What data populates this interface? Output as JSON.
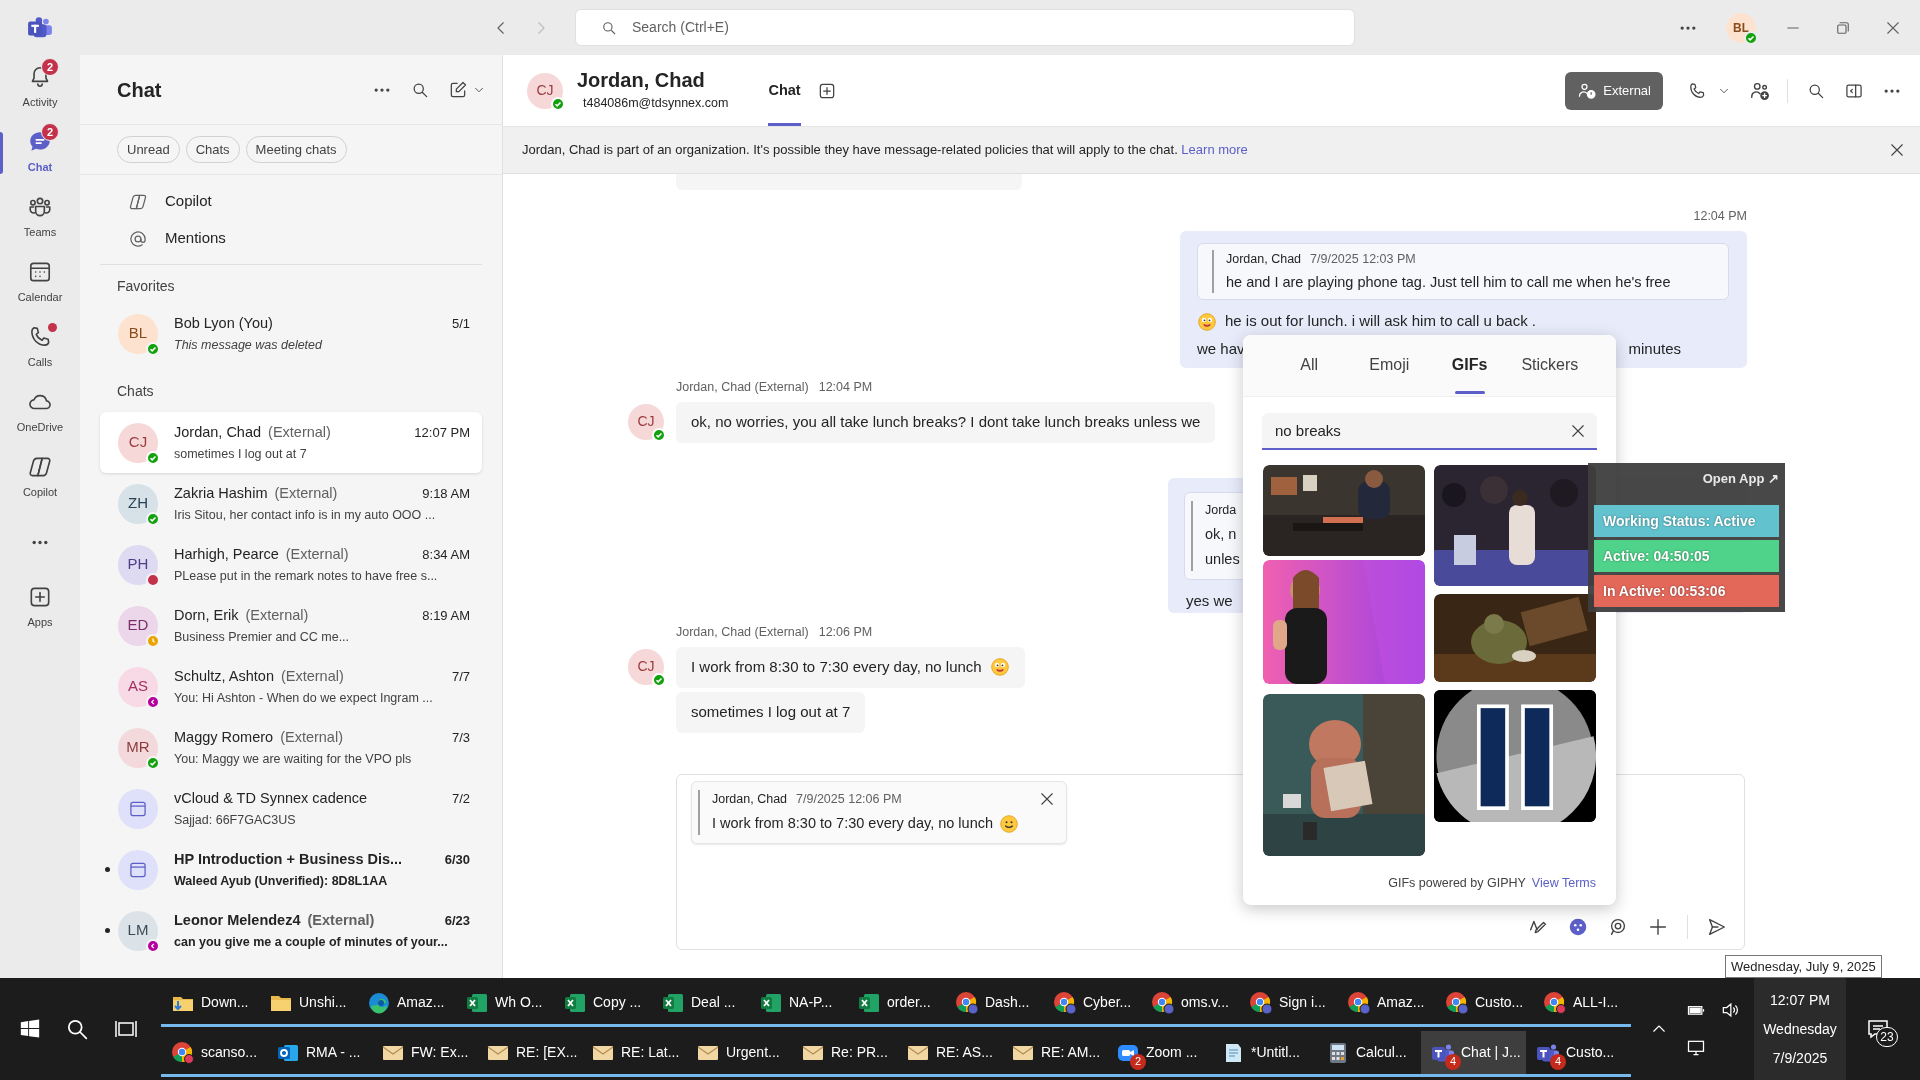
{
  "title_bar": {
    "search_placeholder": "Search (Ctrl+E)",
    "user": {
      "initials": "BL",
      "color": "#13a10e"
    }
  },
  "app_rail": [
    {
      "kind": "activity",
      "label": "Activity",
      "badge": "2",
      "dot": false,
      "selected": false
    },
    {
      "kind": "chat",
      "label": "Chat",
      "badge": "2",
      "dot": false,
      "selected": true
    },
    {
      "kind": "teams",
      "label": "Teams",
      "dot": false,
      "selected": false
    },
    {
      "kind": "calendar",
      "label": "Calendar",
      "dot": false,
      "selected": false
    },
    {
      "kind": "calls",
      "label": "Calls",
      "dot": true,
      "selected": false
    },
    {
      "kind": "onedrive",
      "label": "OneDrive",
      "dot": false,
      "selected": false
    },
    {
      "kind": "copilot",
      "label": "Copilot",
      "dot": false,
      "selected": false
    },
    {
      "kind": "more",
      "dot": false,
      "selected": false
    },
    {
      "kind": "apps",
      "label": "Apps",
      "dot": false,
      "selected": false
    }
  ],
  "chat_list": {
    "title": "Chat",
    "filters": [
      {
        "label": "Unread",
        "selected": false
      },
      {
        "label": "Chats",
        "selected": false
      },
      {
        "label": "Meeting chats",
        "selected": false
      }
    ],
    "shortcuts": [
      {
        "kind": "copilot",
        "label": "Copilot"
      },
      {
        "kind": "mentions",
        "label": "Mentions"
      }
    ],
    "favorites_heading": "Favorites",
    "favorites": [
      {
        "kind": "person",
        "initials": "BL",
        "name": "Bob Lyon (You)",
        "preview": "This message was deleted",
        "deleted": true,
        "time": "5/1",
        "color": "#13a10e",
        "unread": false,
        "selected": false
      }
    ],
    "chats_heading": "Chats",
    "chats": [
      {
        "kind": "person",
        "initials": "CJ",
        "name": "Jordan, Chad",
        "tag": "(External)",
        "preview": "sometimes I log out at 7",
        "deleted": false,
        "time": "12:07 PM",
        "color": "#13a10e",
        "unread": false,
        "selected": true
      },
      {
        "kind": "person",
        "initials": "ZH",
        "name": "Zakria Hashim",
        "tag": "(External)",
        "preview": "Iris Sitou, her contact info is in my auto OOO ...",
        "deleted": false,
        "time": "9:18 AM",
        "color": "#13a10e",
        "unread": false,
        "selected": false
      },
      {
        "kind": "person",
        "initials": "PH",
        "name": "Harhigh, Pearce",
        "tag": "(External)",
        "preview": "PLease put in the remark notes to have free s...",
        "deleted": false,
        "time": "8:34 AM",
        "color": "#c4314b",
        "unread": false,
        "selected": false
      },
      {
        "kind": "person",
        "initials": "ED",
        "name": "Dorn, Erik",
        "tag": "(External)",
        "preview": "Business Premier and CC me...",
        "deleted": false,
        "time": "8:19 AM",
        "color": "#eaa300",
        "unread": false,
        "selected": false
      },
      {
        "kind": "person",
        "initials": "AS",
        "name": "Schultz, Ashton",
        "tag": "(External)",
        "preview": "You: Hi Ashton -  When do we expect Ingram ...",
        "deleted": false,
        "time": "7/7",
        "color": "#b4009e",
        "unread": false,
        "selected": false
      },
      {
        "kind": "person",
        "initials": "MR",
        "name": "Maggy Romero",
        "tag": "(External)",
        "preview": "You: Maggy we are waiting for the VPO pls",
        "deleted": false,
        "time": "7/3",
        "color": "#13a10e",
        "unread": false,
        "selected": false
      },
      {
        "kind": "meeting",
        "name": "vCloud & TD Synnex cadence",
        "preview": "Sajjad: 66F7GAC3US",
        "deleted": false,
        "time": "7/2",
        "unread": false,
        "selected": false
      },
      {
        "kind": "meeting",
        "name": "HP Introduction + Business Dis...",
        "preview": "Waleed Ayub (Unverified): 8D8L1AA",
        "deleted": false,
        "time": "6/30",
        "unread": true,
        "selected": false
      },
      {
        "kind": "person",
        "initials": "LM",
        "name": "Leonor Melendez4",
        "tag": "(External)",
        "preview": "can you give me a couple of minutes of your...",
        "deleted": false,
        "time": "6/23",
        "color": "#b4009e",
        "unread": true,
        "selected": false
      }
    ]
  },
  "conversation": {
    "contact": {
      "initials": "CJ",
      "name": "Jordan, Chad",
      "email": "t484086m@tdsynnex.com",
      "color": "#13a10e"
    },
    "tabs": [
      {
        "label": "Chat",
        "selected": true
      }
    ],
    "external_label": "External",
    "banner": {
      "text": "Jordan, Chad is part of an organization. It's possible they have message-related policies that will apply to the chat.",
      "link": "Learn more"
    },
    "time_divider": "12:04 PM",
    "sent_1": {
      "quote_author": "Jordan, Chad",
      "quote_time": "7/9/2025 12:03 PM",
      "quote_text": "he and I are playing phone tag. Just tell him to call me when he's free",
      "line_1": "he is out for lunch. i will ask him to call u back .",
      "line_1_emoji": true,
      "line_2_start": "we hav",
      "line_2_end": "minutes"
    },
    "received_1": {
      "sender": "Jordan, Chad (External)",
      "time": "12:04 PM",
      "avatar_initials": "CJ",
      "color": "#13a10e",
      "bubbles": [
        {
          "text": "ok, no worries, you all take lunch breaks?  I dont take lunch breaks unless we",
          "emoji": false
        }
      ]
    },
    "sent_2": {
      "quote_author": "Jorda",
      "quote_lines": [
        "ok, n",
        "unles"
      ],
      "text": "yes we"
    },
    "received_2": {
      "sender": "Jordan, Chad (External)",
      "time": "12:06 PM",
      "avatar_initials": "CJ",
      "color": "#13a10e",
      "bubbles": [
        {
          "text": "I work from 8:30 to 7:30 every day, no lunch",
          "emoji": true
        },
        {
          "text": "sometimes I log out at 7",
          "emoji": false
        }
      ]
    },
    "compose": {
      "reply": {
        "author": "Jordan, Chad",
        "time": "7/9/2025 12:06 PM",
        "text": "I work from 8:30 to 7:30 every day, no lunch",
        "emoji": true
      }
    }
  },
  "gif_picker": {
    "tabs": [
      {
        "label": "All",
        "selected": false
      },
      {
        "label": "Emoji",
        "selected": false
      },
      {
        "label": "GIFs",
        "selected": true
      },
      {
        "label": "Stickers",
        "selected": false
      }
    ],
    "search_value": "no breaks",
    "footer": "GIFs powered by GIPHY",
    "footer_link": "View Terms"
  },
  "status_widget": {
    "open_app": "Open App ↗",
    "rows": [
      {
        "text": "Working Status: Active",
        "color": "#62c3cf"
      },
      {
        "text": "Active: 04:50:05",
        "color": "#4fd38a"
      },
      {
        "text": "In Active: 00:53:06",
        "color": "#e4685a"
      }
    ]
  },
  "tooltip": "Wednesday, July 9, 2025",
  "taskbar": {
    "row_1": [
      {
        "kind": "download_folder",
        "label": "Down...",
        "selected": false
      },
      {
        "kind": "folder",
        "label": "Unshi...",
        "selected": false
      },
      {
        "kind": "edge",
        "label": "Amaz...",
        "selected": false
      },
      {
        "kind": "excel",
        "label": "Wh O...",
        "selected": false
      },
      {
        "kind": "excel",
        "label": "Copy ...",
        "selected": false
      },
      {
        "kind": "excel",
        "label": "Deal ...",
        "selected": false
      },
      {
        "kind": "excel",
        "label": "NA-P...",
        "selected": false
      },
      {
        "kind": "excel",
        "label": "order...",
        "selected": false
      },
      {
        "kind": "chrome_profile",
        "label": "Dash...",
        "selected": false
      },
      {
        "kind": "chrome_profile",
        "label": "Cyber...",
        "selected": false
      },
      {
        "kind": "chrome_profile",
        "label": "oms.v...",
        "selected": false
      },
      {
        "kind": "chrome_profile",
        "label": "Sign i...",
        "selected": false
      },
      {
        "kind": "chrome_profile",
        "label": "Amaz...",
        "selected": false
      },
      {
        "kind": "chrome_profile",
        "label": "Custo...",
        "selected": false
      },
      {
        "kind": "chrome_red",
        "label": "ALL-I...",
        "selected": false
      }
    ],
    "row_2": [
      {
        "kind": "chrome_red",
        "label": "scanso...",
        "selected": false
      },
      {
        "kind": "outlook",
        "label": "RMA - ...",
        "selected": false
      },
      {
        "kind": "mail",
        "label": "FW: Ex...",
        "selected": false
      },
      {
        "kind": "mail",
        "label": "RE: [EX...",
        "selected": false
      },
      {
        "kind": "mail",
        "label": "RE: Lat...",
        "selected": false
      },
      {
        "kind": "mail",
        "label": "Urgent...",
        "selected": false
      },
      {
        "kind": "mail",
        "label": "Re: PR...",
        "selected": false
      },
      {
        "kind": "mail",
        "label": "RE: AS...",
        "selected": false
      },
      {
        "kind": "mail",
        "label": "RE: AM...",
        "selected": false
      },
      {
        "kind": "zoom",
        "label": "Zoom ...",
        "badge": "2",
        "selected": false
      },
      {
        "kind": "notepad",
        "label": "*Untitl...",
        "selected": false
      },
      {
        "kind": "calculator",
        "label": "Calcul...",
        "selected": false
      },
      {
        "kind": "teams",
        "label": "Chat | J...",
        "badge": "4",
        "selected": true
      },
      {
        "kind": "teams",
        "label": "Custo...",
        "badge": "4",
        "selected": false
      }
    ],
    "clock": {
      "time": "12:07 PM",
      "day": "Wednesday",
      "date": "7/9/2025"
    },
    "notifications": "23"
  }
}
